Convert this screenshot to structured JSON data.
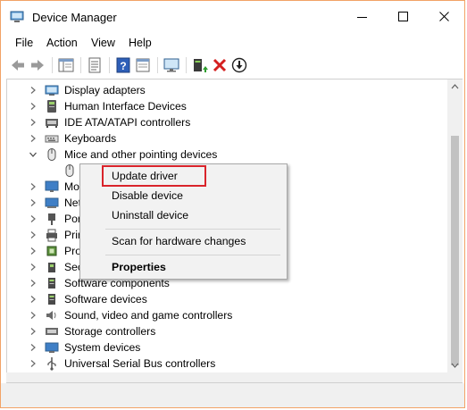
{
  "window": {
    "title": "Device Manager",
    "controls": {
      "minimize": "minimize-icon",
      "maximize": "maximize-icon",
      "close": "close-icon"
    },
    "accent_border": "#f2a366"
  },
  "menu": {
    "file": "File",
    "action": "Action",
    "view": "View",
    "help": "Help"
  },
  "toolbar": [
    "back-arrow-icon",
    "forward-arrow-icon",
    "show-hide-console-tree-icon",
    "properties-sheet-icon",
    "help-icon",
    "monitor-icon",
    "update-driver-icon",
    "uninstall-x-icon",
    "disable-down-arrow-icon"
  ],
  "tree": {
    "items": [
      {
        "label": "Display adapters",
        "expanded": false,
        "icon": "display-adapter-icon"
      },
      {
        "label": "Human Interface Devices",
        "expanded": false,
        "icon": "hid-icon"
      },
      {
        "label": "IDE ATA/ATAPI controllers",
        "expanded": false,
        "icon": "ide-controller-icon"
      },
      {
        "label": "Keyboards",
        "expanded": false,
        "icon": "keyboard-icon"
      },
      {
        "label": "Mice and other pointing devices",
        "expanded": true,
        "icon": "mouse-icon"
      },
      {
        "label": "",
        "child": true,
        "icon": "mouse-device-icon"
      },
      {
        "label": "Mo",
        "expanded": false,
        "icon": "monitor-icon"
      },
      {
        "label": "Net",
        "expanded": false,
        "icon": "network-adapter-icon"
      },
      {
        "label": "Por",
        "expanded": false,
        "icon": "ports-icon"
      },
      {
        "label": "Prin",
        "expanded": false,
        "icon": "print-queue-icon"
      },
      {
        "label": "Pro",
        "expanded": false,
        "icon": "processor-icon"
      },
      {
        "label": "Sec",
        "expanded": false,
        "icon": "security-device-icon"
      },
      {
        "label": "Software components",
        "expanded": false,
        "icon": "software-component-icon"
      },
      {
        "label": "Software devices",
        "expanded": false,
        "icon": "software-device-icon"
      },
      {
        "label": "Sound, video and game controllers",
        "expanded": false,
        "icon": "sound-icon"
      },
      {
        "label": "Storage controllers",
        "expanded": false,
        "icon": "storage-controller-icon"
      },
      {
        "label": "System devices",
        "expanded": false,
        "icon": "system-device-icon"
      },
      {
        "label": "Universal Serial Bus controllers",
        "expanded": false,
        "icon": "usb-icon"
      }
    ]
  },
  "context_menu": {
    "update_driver": "Update driver",
    "disable_device": "Disable device",
    "uninstall_device": "Uninstall device",
    "scan": "Scan for hardware changes",
    "properties": "Properties",
    "highlight_color": "#d9242b"
  }
}
